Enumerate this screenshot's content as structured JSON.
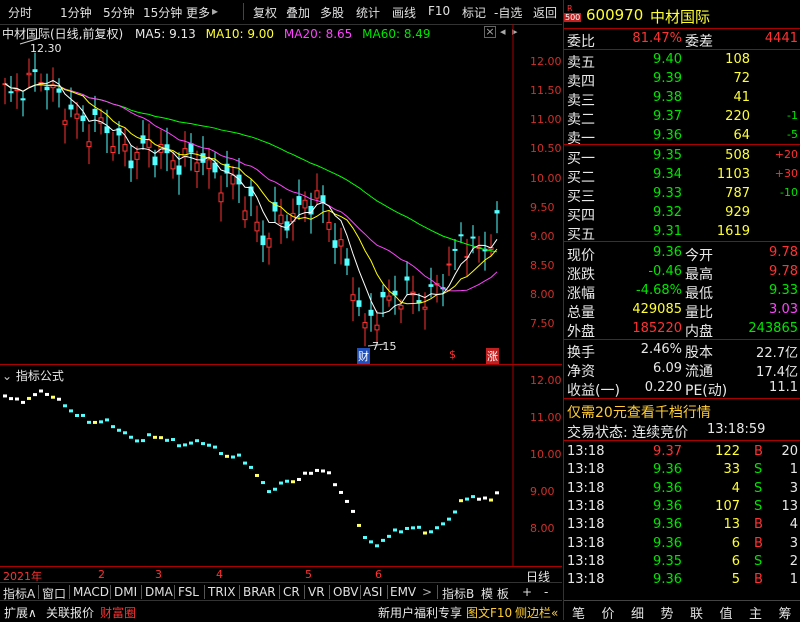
{
  "toolbar": {
    "items": [
      "分时",
      "1分钟",
      "5分钟",
      "15分钟",
      "更多",
      "复权",
      "叠加",
      "多股",
      "统计",
      "画线",
      "F10",
      "标记",
      "-自选",
      "返回"
    ],
    "more_arrow": "▸"
  },
  "main_chart": {
    "title": "中材国际(日线,前复权)",
    "ma5_label": "MA5: 9.13",
    "ma10_label": "MA10: 9.00",
    "ma20_label": "MA20: 8.65",
    "ma60_label": "MA60: 8.49",
    "high_label": "12.30",
    "low_label": "7.15",
    "marker_cai": "财",
    "marker_dollar": "$",
    "marker_zhang": "涨",
    "y_ticks": [
      "12.00",
      "11.50",
      "11.00",
      "10.50",
      "10.00",
      "9.50",
      "9.00",
      "8.50",
      "8.00",
      "7.50"
    ],
    "colors": {
      "ma5": "#ffffff",
      "ma10": "#ffff00",
      "ma20": "#ff44ff",
      "ma60": "#00ff00",
      "up": "#ff3232",
      "down": "#54ffff"
    }
  },
  "indicator_chart": {
    "title": "指标公式",
    "y_ticks": [
      "12.00",
      "11.00",
      "10.00",
      "9.00",
      "8.00"
    ]
  },
  "date_axis": {
    "labels": [
      "2021年",
      "2",
      "3",
      "4",
      "5",
      "6"
    ],
    "period": "日线"
  },
  "tabs_row": {
    "items": [
      "指标A",
      "窗口",
      "MACD",
      "DMI",
      "DMA",
      "FSL",
      "TRIX",
      "BRAR",
      "CR",
      "VR",
      "OBV",
      "ASI",
      "EMV"
    ],
    "right_items": [
      "指标B",
      "模 板",
      "+",
      "-"
    ],
    "nav_arrow": ">"
  },
  "bottom_bar": {
    "expand": "扩展∧",
    "linkage": "关联报价",
    "wealth": "财富圈",
    "promo": "新用户福利专享",
    "f10": "图文F10",
    "sidebar": "侧边栏«"
  },
  "quote": {
    "badge_r": "R",
    "badge_num": "500",
    "code": "600970",
    "name": "中材国际",
    "weibi_label": "委比",
    "weibi_value": "81.47%",
    "weicha_label": "委差",
    "weicha_value": "4441",
    "sell": [
      {
        "label": "卖五",
        "price": "9.40",
        "vol": "108",
        "chg": ""
      },
      {
        "label": "卖四",
        "price": "9.39",
        "vol": "72",
        "chg": ""
      },
      {
        "label": "卖三",
        "price": "9.38",
        "vol": "41",
        "chg": ""
      },
      {
        "label": "卖二",
        "price": "9.37",
        "vol": "220",
        "chg": "-1"
      },
      {
        "label": "卖一",
        "price": "9.36",
        "vol": "64",
        "chg": "-5"
      }
    ],
    "buy": [
      {
        "label": "买一",
        "price": "9.35",
        "vol": "508",
        "chg": "+20"
      },
      {
        "label": "买二",
        "price": "9.34",
        "vol": "1103",
        "chg": "+30"
      },
      {
        "label": "买三",
        "price": "9.33",
        "vol": "787",
        "chg": "-10"
      },
      {
        "label": "买四",
        "price": "9.32",
        "vol": "929",
        "chg": ""
      },
      {
        "label": "买五",
        "price": "9.31",
        "vol": "1619",
        "chg": ""
      }
    ],
    "stats": [
      {
        "l1": "现价",
        "v1": "9.36",
        "l2": "今开",
        "v2": "9.78"
      },
      {
        "l1": "涨跌",
        "v1": "-0.46",
        "l2": "最高",
        "v2": "9.78"
      },
      {
        "l1": "涨幅",
        "v1": "-4.68%",
        "l2": "最低",
        "v2": "9.33"
      },
      {
        "l1": "总量",
        "v1": "429085",
        "l2": "量比",
        "v2": "3.03"
      },
      {
        "l1": "外盘",
        "v1": "185220",
        "l2": "内盘",
        "v2": "243865"
      }
    ],
    "fund": [
      {
        "l1": "换手",
        "v1": "2.46%",
        "l2": "股本",
        "v2": "22.7亿"
      },
      {
        "l1": "净资",
        "v1": "6.09",
        "l2": "流通",
        "v2": "17.4亿"
      },
      {
        "l1": "收益(一)",
        "v1": "0.220",
        "l2": "PE(动)",
        "v2": "11.1"
      }
    ],
    "promo": "仅需20元查看千档行情",
    "status_label": "交易状态: 连续竞价",
    "status_time": "13:18:59",
    "ticks": [
      {
        "t": "13:18",
        "p": "9.37",
        "v": "122",
        "s": "B",
        "n": "20"
      },
      {
        "t": "13:18",
        "p": "9.36",
        "v": "33",
        "s": "S",
        "n": "1"
      },
      {
        "t": "13:18",
        "p": "9.36",
        "v": "4",
        "s": "S",
        "n": "3"
      },
      {
        "t": "13:18",
        "p": "9.36",
        "v": "107",
        "s": "S",
        "n": "13"
      },
      {
        "t": "13:18",
        "p": "9.36",
        "v": "13",
        "s": "B",
        "n": "4"
      },
      {
        "t": "13:18",
        "p": "9.36",
        "v": "6",
        "s": "B",
        "n": "3"
      },
      {
        "t": "13:18",
        "p": "9.35",
        "v": "6",
        "s": "S",
        "n": "2"
      },
      {
        "t": "13:18",
        "p": "9.36",
        "v": "5",
        "s": "B",
        "n": "1"
      }
    ],
    "side_tabs": [
      "笔",
      "价",
      "细",
      "势",
      "联",
      "值",
      "主",
      "筹"
    ]
  }
}
